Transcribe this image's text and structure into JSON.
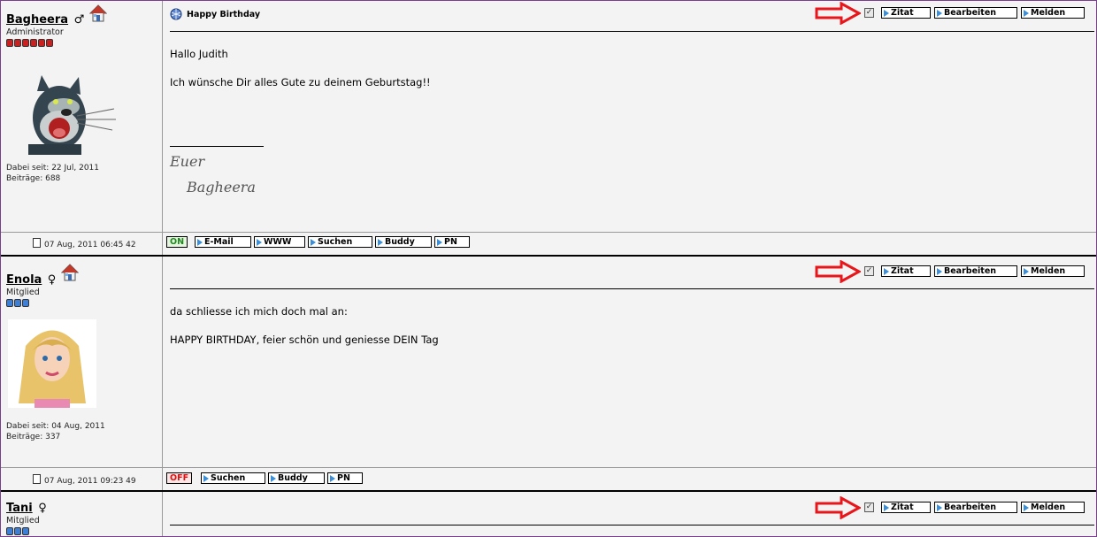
{
  "posts": [
    {
      "username": "Bagheera",
      "gender_symbol": "♂",
      "rank": "Administrator",
      "rank_dots": 6,
      "dot_color": "#cc2020",
      "joined": "Dabei seit: 22 Jul, 2011",
      "posts_count": "Beiträge: 688",
      "title": "Happy Birthday",
      "body": [
        "Hallo Judith",
        "Ich wünsche Dir alles Gute zu deinem Geburtstag!!"
      ],
      "signature": [
        "Euer",
        "Bagheera"
      ],
      "date": "07 Aug, 2011 06:45 42",
      "status": "ON",
      "buttons": [
        "E-Mail",
        "WWW",
        "Suchen",
        "Buddy",
        "PN"
      ]
    },
    {
      "username": "Enola",
      "gender_symbol": "♀",
      "rank": "Mitglied",
      "rank_dots": 3,
      "dot_color": "#3d7fd6",
      "joined": "Dabei seit: 04 Aug, 2011",
      "posts_count": "Beiträge: 337",
      "title": "",
      "body": [
        "da schliesse ich mich doch mal an:",
        "HAPPY BIRTHDAY, feier schön und geniesse DEIN Tag"
      ],
      "date": "07 Aug, 2011 09:23 49",
      "status": "OFF",
      "buttons": [
        "Suchen",
        "Buddy",
        "PN"
      ]
    },
    {
      "username": "Tani",
      "gender_symbol": "♀",
      "rank": "Mitglied",
      "rank_dots": 3,
      "dot_color": "#3d7fd6",
      "title": ""
    }
  ],
  "actions": {
    "quote": "Zitat",
    "edit": "Bearbeiten",
    "report": "Melden"
  },
  "checkbox_mark": "✓",
  "colors": {
    "arrow": "#e8161b",
    "button_triangle": "#3a8fd8",
    "frame": "#7a3f8c"
  }
}
